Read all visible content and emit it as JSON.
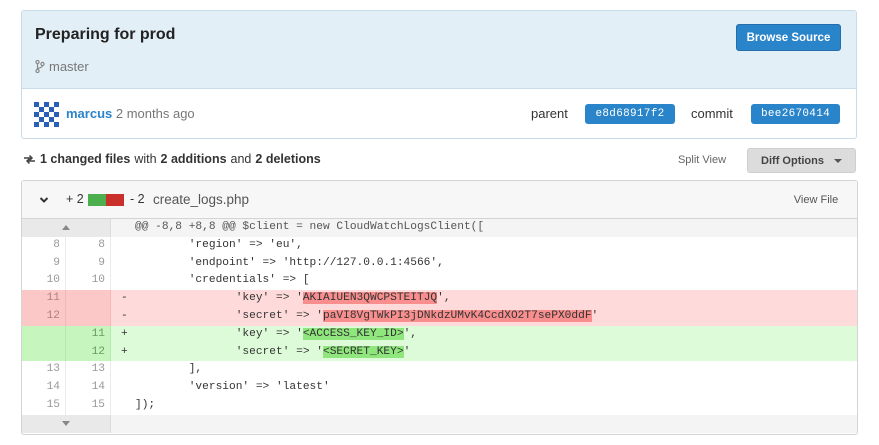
{
  "commit": {
    "title": "Preparing for prod",
    "branch": "master",
    "browse_label": "Browse Source",
    "author": "marcus",
    "date": "2 months ago",
    "parent_label": "parent",
    "parent_sha": "e8d68917f2",
    "commit_label": "commit",
    "commit_sha": "bee2670414"
  },
  "summary": {
    "files_text": "1 changed files",
    "with": "with",
    "additions_text": "2 additions",
    "and": "and",
    "deletions_text": "2 deletions",
    "split_view": "Split View",
    "diff_options": "Diff Options"
  },
  "file": {
    "additions": "+ 2",
    "deletions": "- 2",
    "name": "create_logs.php",
    "view_file": "View File",
    "hunk_header": "@@ -8,8 +8,8 @@ $client = new CloudWatchLogsClient([",
    "lines": [
      {
        "type": "ctx",
        "old": "8",
        "new": "8",
        "marker": "",
        "pre": "        'region' => 'eu',",
        "hl": "",
        "post": ""
      },
      {
        "type": "ctx",
        "old": "9",
        "new": "9",
        "marker": "",
        "pre": "        'endpoint' => 'http://127.0.0.1:4566',",
        "hl": "",
        "post": ""
      },
      {
        "type": "ctx",
        "old": "10",
        "new": "10",
        "marker": "",
        "pre": "        'credentials' => [",
        "hl": "",
        "post": ""
      },
      {
        "type": "del",
        "old": "11",
        "new": "",
        "marker": "-",
        "pre": "               'key' => '",
        "hl": "AKIAIUEN3QWCPSTEITJQ",
        "post": "',"
      },
      {
        "type": "del",
        "old": "12",
        "new": "",
        "marker": "-",
        "pre": "               'secret' => '",
        "hl": "paVI8VgTWkPI3jDNkdzUMvK4CcdXO2T7sePX0ddF",
        "post": "'"
      },
      {
        "type": "add",
        "old": "",
        "new": "11",
        "marker": "+",
        "pre": "               'key' => '",
        "hl": "<ACCESS_KEY_ID>",
        "post": "',"
      },
      {
        "type": "add",
        "old": "",
        "new": "12",
        "marker": "+",
        "pre": "               'secret' => '",
        "hl": "<SECRET_KEY>",
        "post": "'"
      },
      {
        "type": "ctx",
        "old": "13",
        "new": "13",
        "marker": "",
        "pre": "        ],",
        "hl": "",
        "post": ""
      },
      {
        "type": "ctx",
        "old": "14",
        "new": "14",
        "marker": "",
        "pre": "        'version' => 'latest'",
        "hl": "",
        "post": ""
      },
      {
        "type": "ctx",
        "old": "15",
        "new": "15",
        "marker": "",
        "pre": "]);",
        "hl": "",
        "post": ""
      }
    ]
  },
  "colors": {
    "accent": "#2a84c9",
    "header_bg": "#e3eff7",
    "deletion_bg": "#ffdada",
    "addition_bg": "#ddfbd8"
  },
  "icons": {
    "branch": "branch-icon",
    "changes": "sync-arrows-icon",
    "collapse": "chevron-down-icon",
    "expand_up": "expand-up-icon",
    "expand_down": "expand-down-icon"
  }
}
